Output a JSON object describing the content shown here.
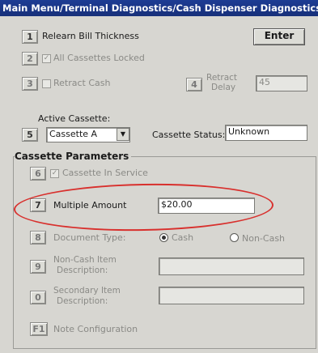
{
  "title": "Main Menu/Terminal Diagnostics/Cash Dispenser Diagnostics/Ca...",
  "rows": {
    "relearn": {
      "key": "1",
      "label": "Relearn Bill Thickness"
    },
    "enter": {
      "label": "Enter"
    },
    "all_locked": {
      "key": "2",
      "label": "All Cassettes Locked",
      "checked": true
    },
    "retract_cash": {
      "key": "3",
      "label": "Retract Cash",
      "checked": false
    },
    "retract_delay": {
      "key": "4",
      "label_line1": "Retract",
      "label_line2": "Delay",
      "value": "45"
    },
    "active_cassette": {
      "label": "Active Cassette:",
      "key": "5",
      "value": "Cassette A"
    },
    "cassette_status": {
      "label": "Cassette Status:",
      "value": "Unknown"
    },
    "params_title": "Cassette Parameters",
    "in_service": {
      "key": "6",
      "label": "Cassette In Service",
      "checked": true
    },
    "multiple_amount": {
      "key": "7",
      "label": "Multiple Amount",
      "value": "$20.00"
    },
    "doc_type": {
      "key": "8",
      "label": "Document Type:",
      "opt_cash": "Cash",
      "opt_noncash": "Non-Cash",
      "selected": "Cash"
    },
    "noncash_desc": {
      "key": "9",
      "label_line1": "Non-Cash Item",
      "label_line2": "Description:",
      "value": ""
    },
    "secondary_desc": {
      "key": "0",
      "label_line1": "Secondary Item",
      "label_line2": "Description:",
      "value": ""
    },
    "note_config": {
      "key": "F1",
      "label": "Note Configuration"
    }
  },
  "colors": {
    "titlebar": "#1d3c94",
    "highlight_ellipse": "#d8302d",
    "background": "#d7d6d1"
  },
  "icons": {
    "dropdown": "chevron-down-icon",
    "checkmark": "check-icon"
  }
}
